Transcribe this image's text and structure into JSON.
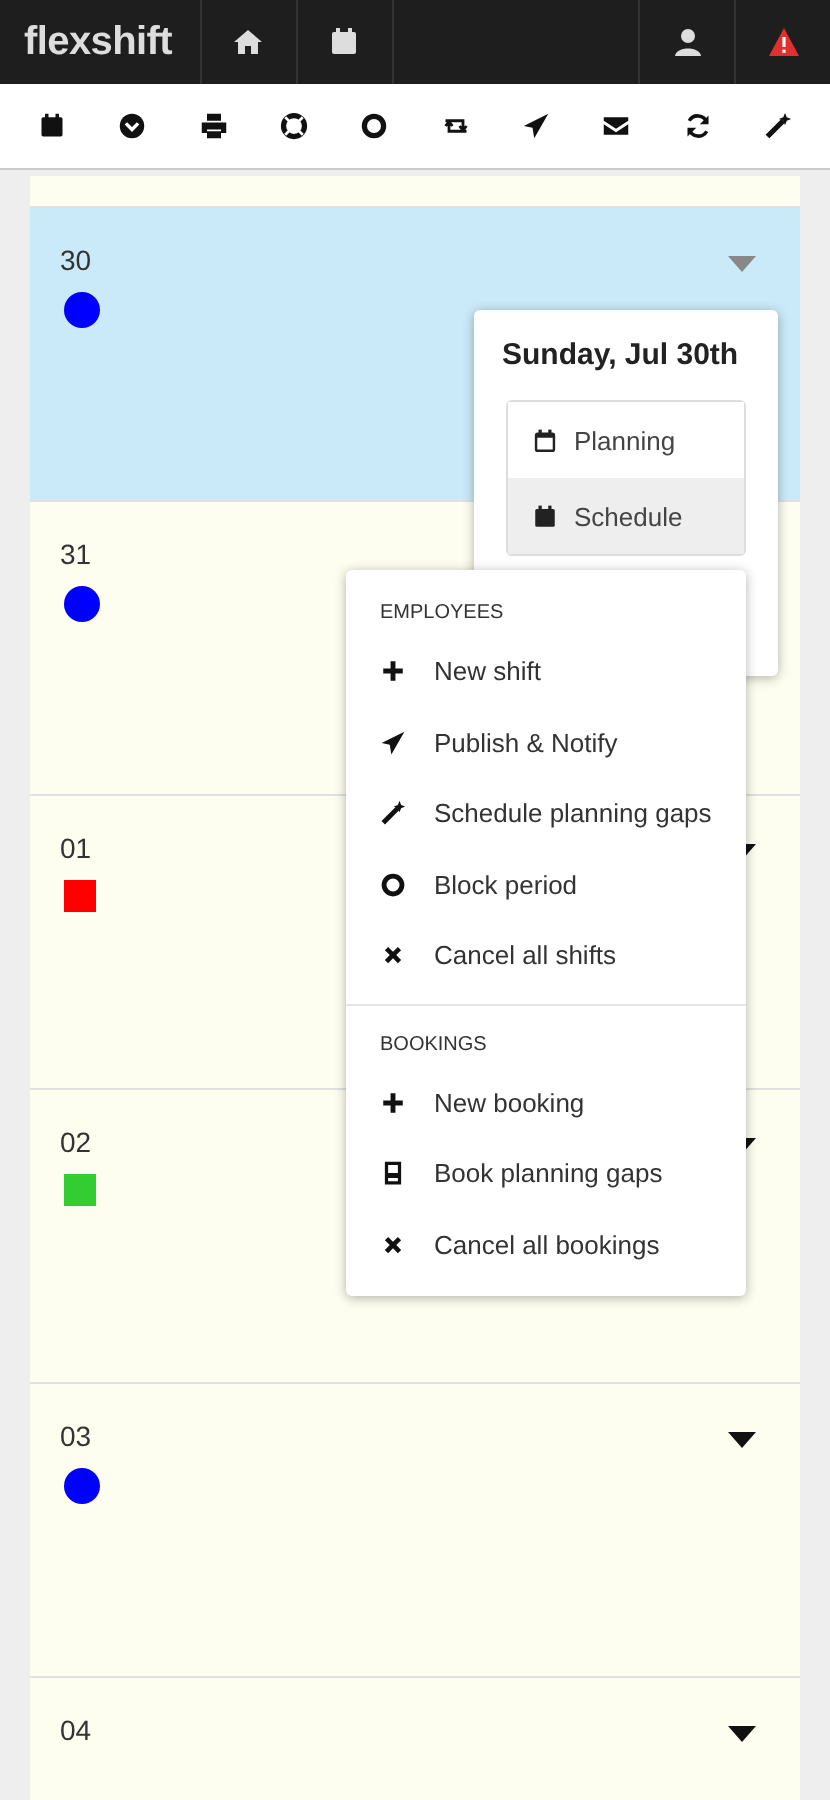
{
  "header": {
    "logo": "flexshift",
    "alert": true
  },
  "days": [
    {
      "label": "30",
      "selected": true,
      "caret": true,
      "marker": {
        "kind": "circle",
        "color": "#0000ff"
      }
    },
    {
      "label": "31",
      "selected": false,
      "marker": {
        "kind": "circle",
        "color": "#0000ff"
      }
    },
    {
      "label": "01",
      "selected": false,
      "caret": true,
      "marker": {
        "kind": "square",
        "color": "#ff0000"
      }
    },
    {
      "label": "02",
      "selected": false,
      "caret": true,
      "marker": {
        "kind": "square",
        "color": "#33cc33"
      }
    },
    {
      "label": "03",
      "selected": false,
      "caret": true,
      "marker": {
        "kind": "circle",
        "color": "#0000ff"
      }
    },
    {
      "label": "04",
      "selected": false,
      "caret": true
    }
  ],
  "popover": {
    "title": "Sunday, Jul 30th",
    "options": [
      {
        "label": "Planning",
        "kind": "outline",
        "selected": false
      },
      {
        "label": "Schedule",
        "kind": "filled",
        "selected": true
      }
    ]
  },
  "menu": {
    "sections": [
      {
        "heading": "EMPLOYEES",
        "items": [
          {
            "label": "New shift",
            "kind": "add"
          },
          {
            "label": "Publish & Notify",
            "kind": "send"
          },
          {
            "label": "Schedule planning gaps",
            "kind": "wand"
          },
          {
            "label": "Block period",
            "kind": "block"
          },
          {
            "label": "Cancel all shifts",
            "kind": "cancel"
          }
        ]
      },
      {
        "heading": "BOOKINGS",
        "items": [
          {
            "label": "New booking",
            "kind": "add"
          },
          {
            "label": "Book planning gaps",
            "kind": "book"
          },
          {
            "label": "Cancel all bookings",
            "kind": "cancel"
          }
        ]
      }
    ]
  }
}
